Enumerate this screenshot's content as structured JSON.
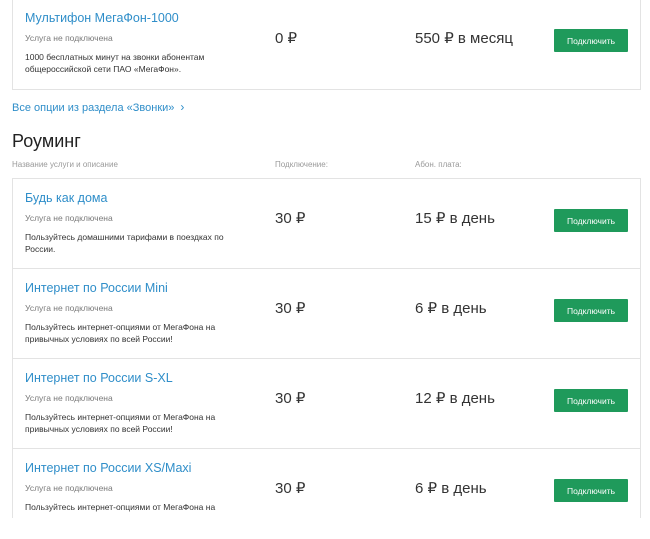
{
  "calls_option": {
    "name": "Мультифон МегаФон-1000",
    "status": "Услуга не подключена",
    "description": "1000 бесплатных минут на звонки абонентам общероссийской сети ПАО «МегаФон».",
    "connect_price": "0 ₽",
    "fee": "550 ₽ в месяц",
    "button": "Подключить"
  },
  "more_link": {
    "label": "Все опции из раздела «Звонки»",
    "icon": "chevron-right-icon"
  },
  "roaming": {
    "title": "Роуминг",
    "columns": [
      "Название услуги и описание",
      "Подключение:",
      "Абон. плата:"
    ],
    "items": [
      {
        "name": "Будь как дома",
        "status": "Услуга не подключена",
        "description": "Пользуйтесь домашними тарифами в поездках по России.",
        "connect_price": "30 ₽",
        "fee": "15 ₽ в день",
        "button": "Подключить"
      },
      {
        "name": "Интернет по России Mini",
        "status": "Услуга не подключена",
        "description": "Пользуйтесь интернет-опциями от МегаФона на привычных условиях по всей России!",
        "connect_price": "30 ₽",
        "fee": "6 ₽ в день",
        "button": "Подключить"
      },
      {
        "name": "Интернет по России S-XL",
        "status": "Услуга не подключена",
        "description": "Пользуйтесь интернет-опциями от МегаФона на привычных условиях по всей России!",
        "connect_price": "30 ₽",
        "fee": "12 ₽ в день",
        "button": "Подключить"
      },
      {
        "name": "Интернет по России XS/Maxi",
        "status": "Услуга не подключена",
        "description": "Пользуйтесь интернет-опциями от МегаФона на",
        "connect_price": "30 ₽",
        "fee": "6 ₽ в день",
        "button": "Подключить"
      }
    ]
  },
  "colors": {
    "accent_green": "#1f9a5b",
    "link_blue": "#2f8ec9",
    "border": "#e3e3e3"
  }
}
